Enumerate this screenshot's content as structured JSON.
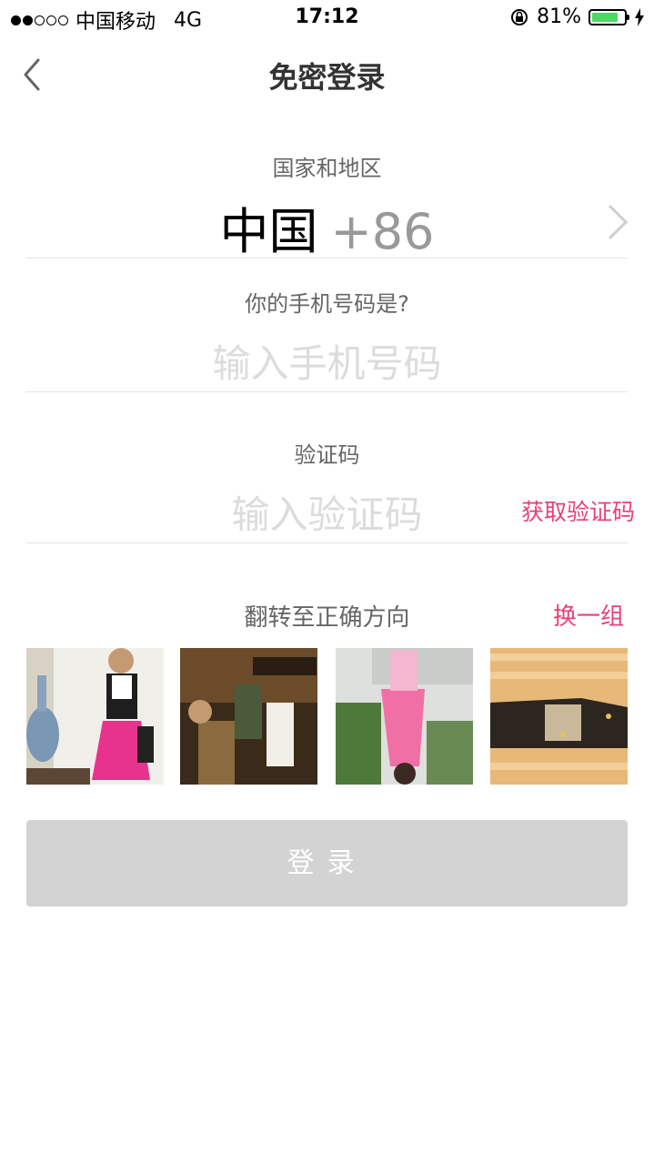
{
  "status_bar": {
    "carrier": "中国移动",
    "network": "4G",
    "time": "17:12",
    "battery": "81%",
    "battery_level": 0.81
  },
  "nav": {
    "title": "免密登录"
  },
  "country": {
    "label": "国家和地区",
    "name": "中国",
    "code": "+86"
  },
  "phone": {
    "label": "你的手机号码是?",
    "placeholder": "输入手机号码"
  },
  "verify": {
    "label": "验证码",
    "placeholder": "输入验证码",
    "get_code": "获取验证码"
  },
  "captcha": {
    "instruction": "翻转至正确方向",
    "refresh": "换一组",
    "images": [
      "photo-1",
      "photo-2",
      "photo-3",
      "photo-4"
    ]
  },
  "login_button": "登录",
  "colors": {
    "accent": "#e8407a",
    "button_disabled": "#d3d3d3",
    "placeholder": "#dcdcdc",
    "battery": "#4cd964"
  }
}
